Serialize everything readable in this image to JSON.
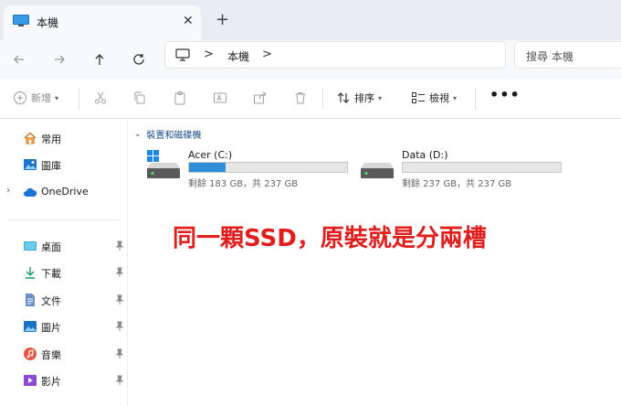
{
  "tab": {
    "title": "本機",
    "close": "✕",
    "new_tab": "+"
  },
  "address": {
    "separator": ">",
    "crumb": "本機",
    "trailing_separator": ">",
    "search_placeholder": "搜尋 本機"
  },
  "toolbar": {
    "new_label": "新增",
    "sort_label": "排序",
    "view_label": "檢視",
    "more": "•••"
  },
  "sidebar": {
    "top_items": [
      {
        "label": "常用",
        "icon": "home-icon"
      },
      {
        "label": "圖庫",
        "icon": "gallery-icon"
      },
      {
        "label": "OneDrive",
        "icon": "cloud-icon"
      }
    ],
    "pinned_items": [
      {
        "label": "桌面",
        "icon": "desktop-icon"
      },
      {
        "label": "下載",
        "icon": "download-icon"
      },
      {
        "label": "文件",
        "icon": "document-icon"
      },
      {
        "label": "圖片",
        "icon": "pictures-icon"
      },
      {
        "label": "音樂",
        "icon": "music-icon"
      },
      {
        "label": "影片",
        "icon": "video-icon"
      }
    ]
  },
  "main": {
    "group_header": "裝置和磁碟機",
    "drives": [
      {
        "name": "Acer (C:)",
        "free_text": "剩餘 183 GB，共 237 GB",
        "used_fraction": 0.23,
        "os": true
      },
      {
        "name": "Data (D:)",
        "free_text": "剩餘 237 GB，共 237 GB",
        "used_fraction": 0.0,
        "os": false
      }
    ]
  },
  "annotation": "同一顆SSD，原裝就是分兩槽",
  "colors": {
    "accent": "#2f8ed8",
    "annotation": "#e11e1e",
    "group_header": "#1f4e8c"
  }
}
